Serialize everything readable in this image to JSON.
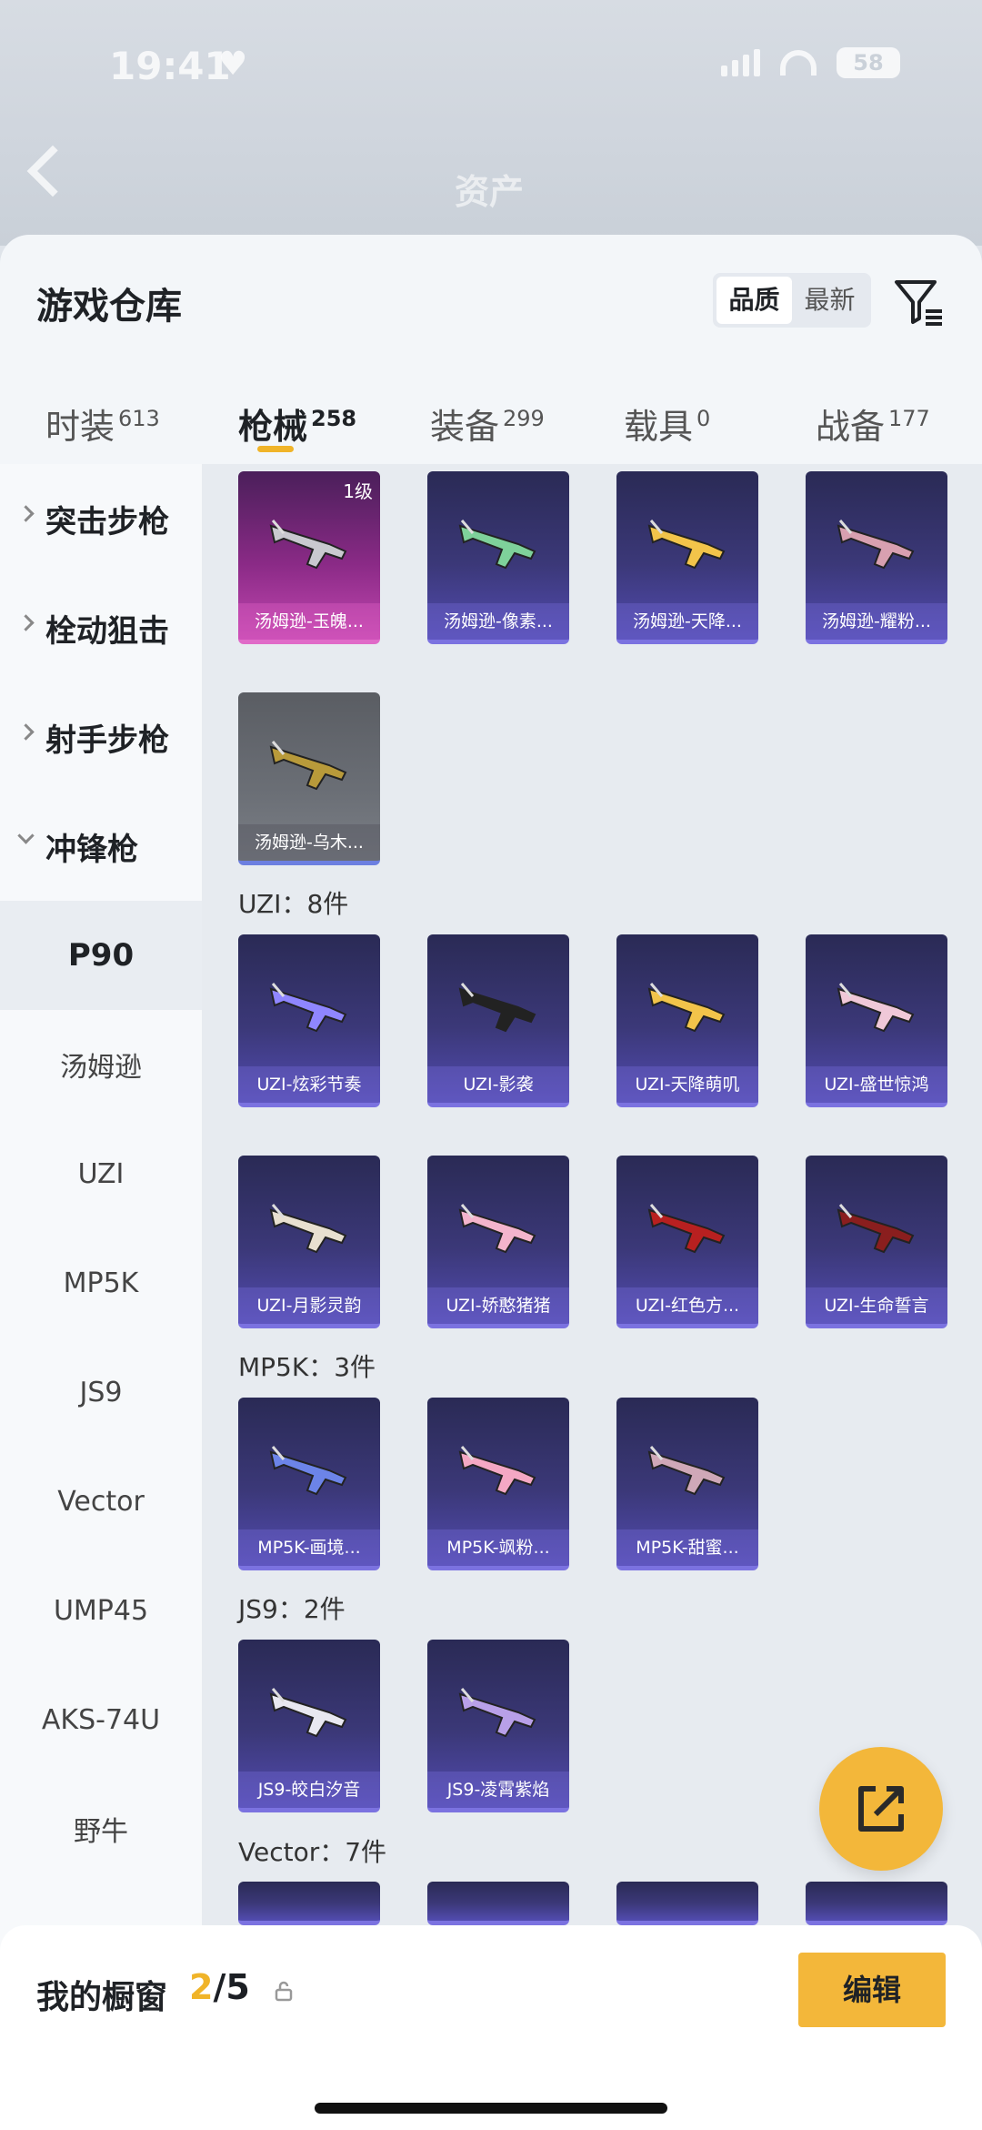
{
  "status": {
    "time": "19:41",
    "battery": "58"
  },
  "page": {
    "title": "资产"
  },
  "panel": {
    "title": "游戏仓库",
    "sort": [
      "品质",
      "最新"
    ]
  },
  "tabs": [
    {
      "label": "时装",
      "count": "613"
    },
    {
      "label": "枪械",
      "count": "258"
    },
    {
      "label": "装备",
      "count": "299"
    },
    {
      "label": "载具",
      "count": "0"
    },
    {
      "label": "战备",
      "count": "177"
    }
  ],
  "sidebar": {
    "categories": [
      "突击步枪",
      "栓动狙击",
      "射手步枪",
      "冲锋枪"
    ],
    "subs": [
      "P90",
      "汤姆逊",
      "UZI",
      "MP5K",
      "JS9",
      "Vector",
      "UMP45",
      "AKS-74U",
      "野牛"
    ]
  },
  "groups": {
    "uzi": "UZI：8件",
    "mp5k": "MP5K：3件",
    "js9": "JS9：2件",
    "vector": "Vector：7件"
  },
  "items": {
    "thompson": [
      "汤姆逊-玉魄...",
      "汤姆逊-像素...",
      "汤姆逊-天降...",
      "汤姆逊-耀粉...",
      "汤姆逊-乌木..."
    ],
    "thompson_level": "1级",
    "uzi": [
      "UZI-炫彩节奏",
      "UZI-影袭",
      "UZI-天降萌叽",
      "UZI-盛世惊鸿",
      "UZI-月影灵韵",
      "UZI-娇憨猪猪",
      "UZI-红色方...",
      "UZI-生命誓言"
    ],
    "mp5k": [
      "MP5K-画境...",
      "MP5K-飒粉...",
      "MP5K-甜蜜..."
    ],
    "js9": [
      "JS9-皎白汐音",
      "JS9-凌霄紫焰"
    ]
  },
  "showcase": {
    "title": "我的橱窗",
    "current": "2",
    "total": "/5",
    "edit": "编辑"
  },
  "colors": {
    "accent": "#f3b73a",
    "purple_card": "#3b3878",
    "pink_card": "#8a2a86"
  }
}
